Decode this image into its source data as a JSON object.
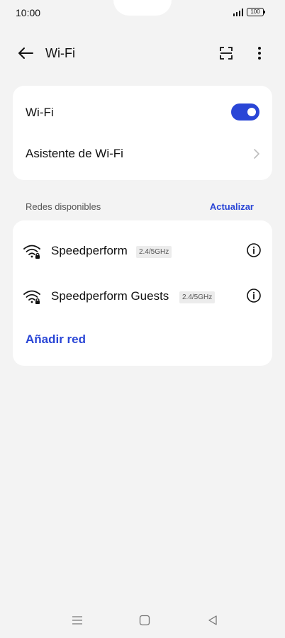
{
  "status_bar": {
    "time": "10:00",
    "battery_level": "100"
  },
  "header": {
    "title": "Wi-Fi",
    "back_icon": "arrow-left-icon",
    "scan_icon": "qr-scan-icon",
    "more_icon": "more-vertical-icon"
  },
  "settings": {
    "wifi_label": "Wi-Fi",
    "wifi_enabled": true,
    "assistant_label": "Asistente de Wi-Fi"
  },
  "networks_section": {
    "label": "Redes disponibles",
    "refresh_label": "Actualizar",
    "networks": [
      {
        "name": "Speedperform",
        "band": "2.4/5GHz"
      },
      {
        "name": "Speedperform Guests",
        "band": "2.4/5GHz"
      }
    ],
    "add_network_label": "Añadir red"
  },
  "colors": {
    "accent": "#2a46d6",
    "background": "#f3f3f3",
    "card": "#ffffff"
  }
}
